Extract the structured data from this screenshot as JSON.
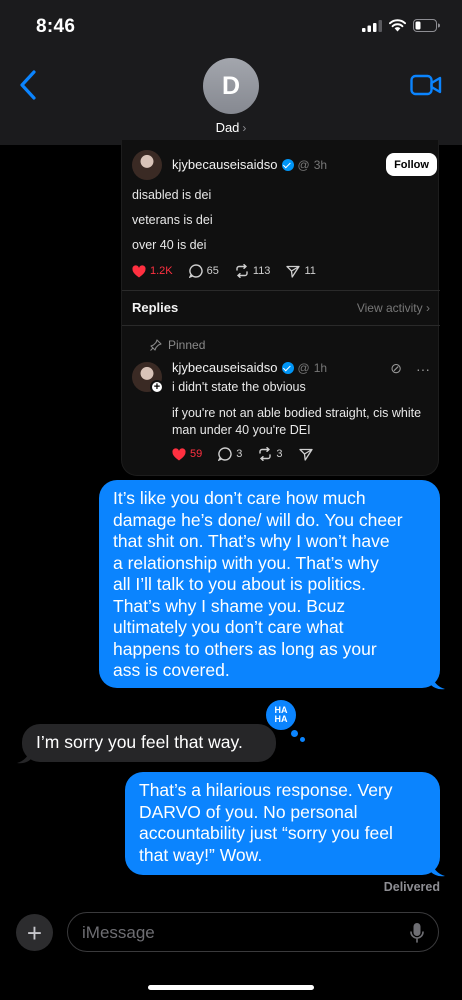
{
  "status_bar": {
    "time": "8:46"
  },
  "header": {
    "contact_initial": "D",
    "contact_name": "Dad"
  },
  "shared_post": {
    "author": "kjybecauseisaidso",
    "age": "3h",
    "follow_label": "Follow",
    "lines": [
      "disabled is dei",
      "veterans is dei",
      "over 40 is dei"
    ],
    "likes": "1.2K",
    "comments": "65",
    "reposts": "113",
    "shares": "11",
    "replies_title": "Replies",
    "view_activity": "View activity",
    "reply": {
      "pinned_label": "Pinned",
      "author": "kjybecauseisaidso",
      "age": "1h",
      "line1": "i didn't state the obvious",
      "line2a": "if you're not an able bodied straight, cis white",
      "line2b": "man under 40 you're DEI",
      "likes": "59",
      "comments": "3",
      "reposts": "3"
    }
  },
  "messages": {
    "outgoing_1": [
      "It’s like you don’t care how much",
      "damage he’s done/ will do. You cheer",
      "that shit on. That’s why I won’t have",
      "a relationship with you. That’s why",
      "all I’ll talk to you about is politics.",
      "That’s why I shame you. Bcuz",
      "ultimately you don’t care what",
      "happens to others as long as your",
      "ass is covered."
    ],
    "tapback_line1": "HA",
    "tapback_line2": "HA",
    "incoming_1": "I’m sorry you feel that way.",
    "outgoing_2": [
      "That’s a hilarious response. Very",
      "DARVO of you. No personal",
      "accountability just “sorry you feel",
      "that way!” Wow."
    ],
    "delivered": "Delivered"
  },
  "input": {
    "placeholder": "iMessage"
  },
  "colors": {
    "imessage_blue": "#0b84fe",
    "incoming_gray": "#262628",
    "like_red": "#ff3040"
  },
  "icons": [
    "signal-icon",
    "wifi-icon",
    "battery-icon",
    "back-chevron-icon",
    "video-camera-icon",
    "verified-badge-icon",
    "heart-icon",
    "comment-icon",
    "repost-icon",
    "share-icon",
    "pin-icon",
    "mic-icon",
    "plus-icon"
  ]
}
